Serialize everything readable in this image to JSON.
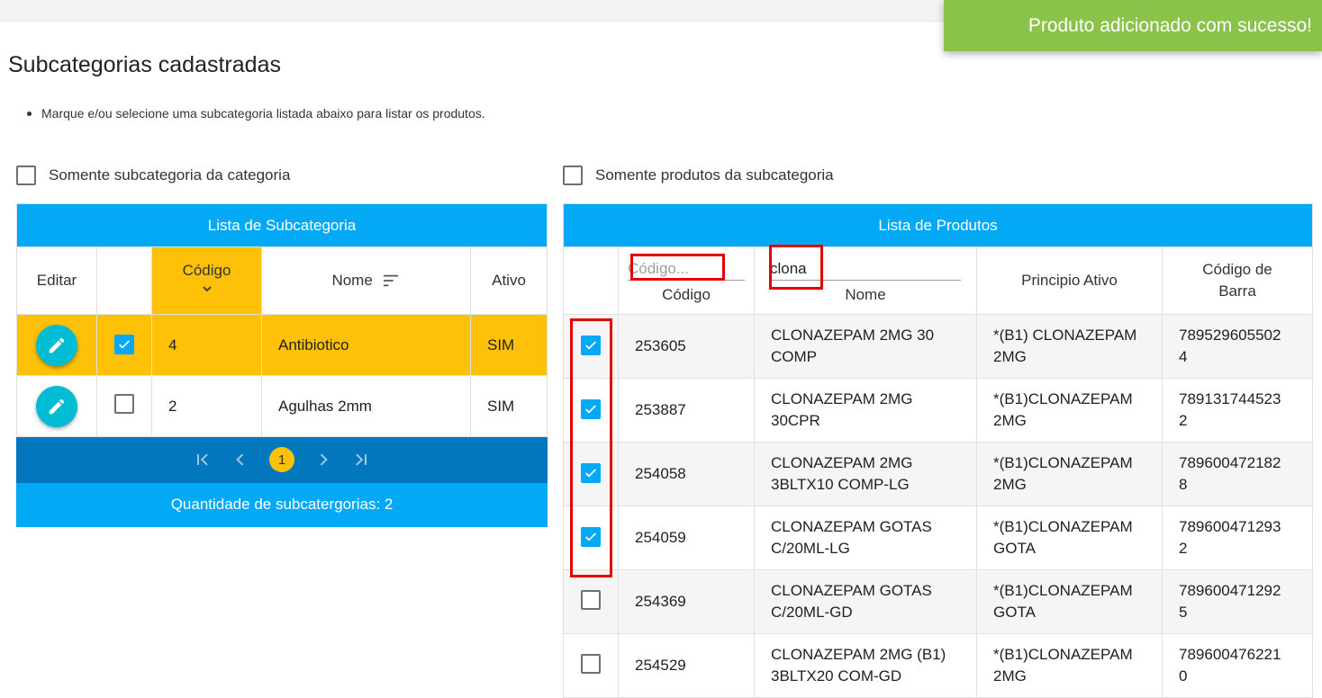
{
  "toast": "Produto adicionado com sucesso!",
  "title": "Subcategorias cadastradas",
  "instruction": "Marque e/ou selecione uma subcategoria listada abaixo para listar os produtos.",
  "filters": {
    "only_category": "Somente subcategoria da categoria",
    "only_subcategory": "Somente produtos da subcategoria"
  },
  "subcategories": {
    "caption": "Lista de Subcategoria",
    "columns": {
      "edit": "Editar",
      "code": "Código",
      "name": "Nome",
      "active": "Ativo"
    },
    "rows": [
      {
        "code": "4",
        "name": "Antibiotico",
        "active": "SIM",
        "checked": true
      },
      {
        "code": "2",
        "name": "Agulhas 2mm",
        "active": "SIM",
        "checked": false
      }
    ],
    "current_page": "1",
    "footer": "Quantidade de subcatergorias: 2"
  },
  "products": {
    "caption": "Lista de Produtos",
    "code_filter_placeholder": "Código...",
    "name_filter_value": "clona",
    "columns": {
      "code": "Código",
      "name": "Nome",
      "active": "Principio Ativo",
      "barcode_1": "Código de",
      "barcode_2": "Barra"
    },
    "rows": [
      {
        "code": "253605",
        "name_1": "CLONAZEPAM 2MG 30",
        "name_2": "COMP",
        "active_1": "*(B1) CLONAZEPAM",
        "active_2": "2MG",
        "bar_1": "789529605502",
        "bar_2": "4",
        "checked": true
      },
      {
        "code": "253887",
        "name_1": "CLONAZEPAM 2MG",
        "name_2": "30CPR",
        "active_1": "*(B1)CLONAZEPAM",
        "active_2": "2MG",
        "bar_1": "789131744523",
        "bar_2": "2",
        "checked": true
      },
      {
        "code": "254058",
        "name_1": "CLONAZEPAM 2MG",
        "name_2": "3BLTX10 COMP-LG",
        "active_1": "*(B1)CLONAZEPAM",
        "active_2": "2MG",
        "bar_1": "789600472182",
        "bar_2": "8",
        "checked": true
      },
      {
        "code": "254059",
        "name_1": "CLONAZEPAM GOTAS",
        "name_2": "C/20ML-LG",
        "active_1": "*(B1)CLONAZEPAM",
        "active_2": "GOTA",
        "bar_1": "789600471293",
        "bar_2": "2",
        "checked": true
      },
      {
        "code": "254369",
        "name_1": "CLONAZEPAM GOTAS",
        "name_2": "C/20ML-GD",
        "active_1": "*(B1)CLONAZEPAM",
        "active_2": "GOTA",
        "bar_1": "789600471292",
        "bar_2": "5",
        "checked": false
      },
      {
        "code": "254529",
        "name_1": "CLONAZEPAM 2MG (B1)",
        "name_2": "3BLTX20 COM-GD",
        "active_1": "*(B1)CLONAZEPAM",
        "active_2": "2MG",
        "bar_1": "789600476221",
        "bar_2": "0",
        "checked": false
      }
    ]
  },
  "colors": {
    "primary": "#03a9f4",
    "primary_dark": "#0277bd",
    "selected_row": "#ffc107",
    "toast": "#8bc34a",
    "edit_button": "#00bcd4",
    "highlight": "#e50000"
  }
}
